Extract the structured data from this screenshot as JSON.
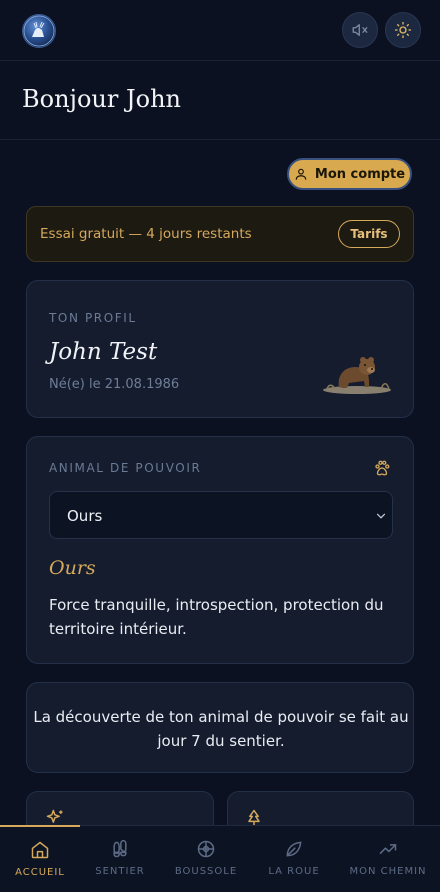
{
  "header": {
    "logo_icon": "moon-deer-logo",
    "sound_button_icon": "speaker-muted-icon",
    "theme_button_icon": "sun-icon"
  },
  "greeting": "Bonjour John",
  "account_button": {
    "label": "Mon compte",
    "icon": "user-icon"
  },
  "trial": {
    "text": "Essai gratuit — 4 jours restants",
    "button": "Tarifs"
  },
  "profile": {
    "eyebrow": "TON PROFIL",
    "name": "John Test",
    "birth": "Né(e) le 21.08.1986"
  },
  "power_animal": {
    "eyebrow": "ANIMAL DE POUVOIR",
    "selected": "Ours",
    "title": "Ours",
    "description": "Force tranquille, introspection, protection du territoire intérieur."
  },
  "info": {
    "text": "La découverte de ton animal de pouvoir se fait au jour 7 du sentier."
  },
  "bottom_nav": [
    {
      "label": "ACCUEIL",
      "icon": "home-icon",
      "active": true
    },
    {
      "label": "SENTIER",
      "icon": "footprints-icon",
      "active": false
    },
    {
      "label": "BOUSSOLE",
      "icon": "compass-icon",
      "active": false
    },
    {
      "label": "LA ROUE",
      "icon": "leaf-icon",
      "active": false
    },
    {
      "label": "MON CHEMIN",
      "icon": "trending-up-icon",
      "active": false
    }
  ],
  "colors": {
    "background": "#0b1120",
    "card": "#141c2e",
    "accent_gold": "#d5a85c",
    "button_gold": "#d9a94f"
  }
}
